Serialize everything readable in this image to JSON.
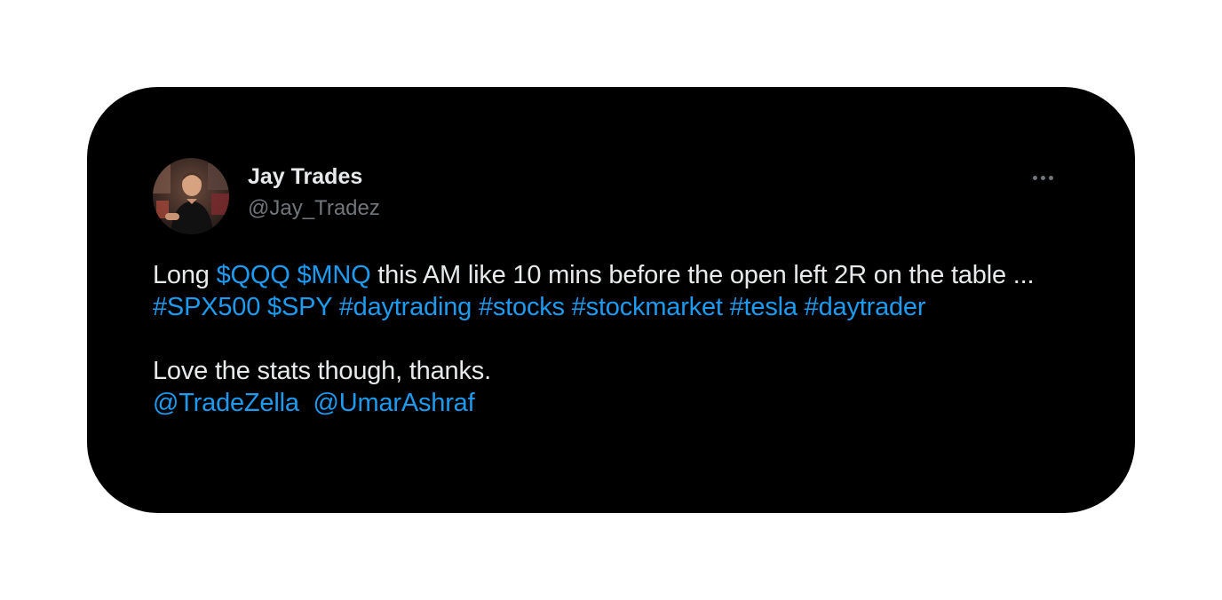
{
  "tweet": {
    "author": {
      "display_name": "Jay Trades",
      "handle": "@Jay_Tradez"
    },
    "more_icon": "more-horizontal-icon",
    "body": {
      "p1": {
        "t1": "Long ",
        "cashtag_qqq": "$QQQ",
        "t2": " ",
        "cashtag_mnq": "$MNQ",
        "t3": " this AM like 10 mins before the open left 2R on the table ... ",
        "hashtag_spx500": "#SPX500",
        "t4": " ",
        "cashtag_spy": "$SPY",
        "t5": " ",
        "hashtag_daytrading": "#daytrading",
        "t6": " ",
        "hashtag_stocks": "#stocks",
        "t7": " ",
        "hashtag_stockmarket": "#stockmarket",
        "t8": " ",
        "hashtag_tesla": "#tesla",
        "t9": " ",
        "hashtag_daytrader": "#daytrader"
      },
      "p2": {
        "text": "Love the stats though, thanks.",
        "mention_tradezella": "@TradeZella",
        "gap": "  ",
        "mention_umarashraf": "@UmarAshraf"
      }
    },
    "colors": {
      "card_background": "#000000",
      "text": "#e7e9ea",
      "secondary_text": "#71767b",
      "link": "#1d9bf0"
    }
  }
}
